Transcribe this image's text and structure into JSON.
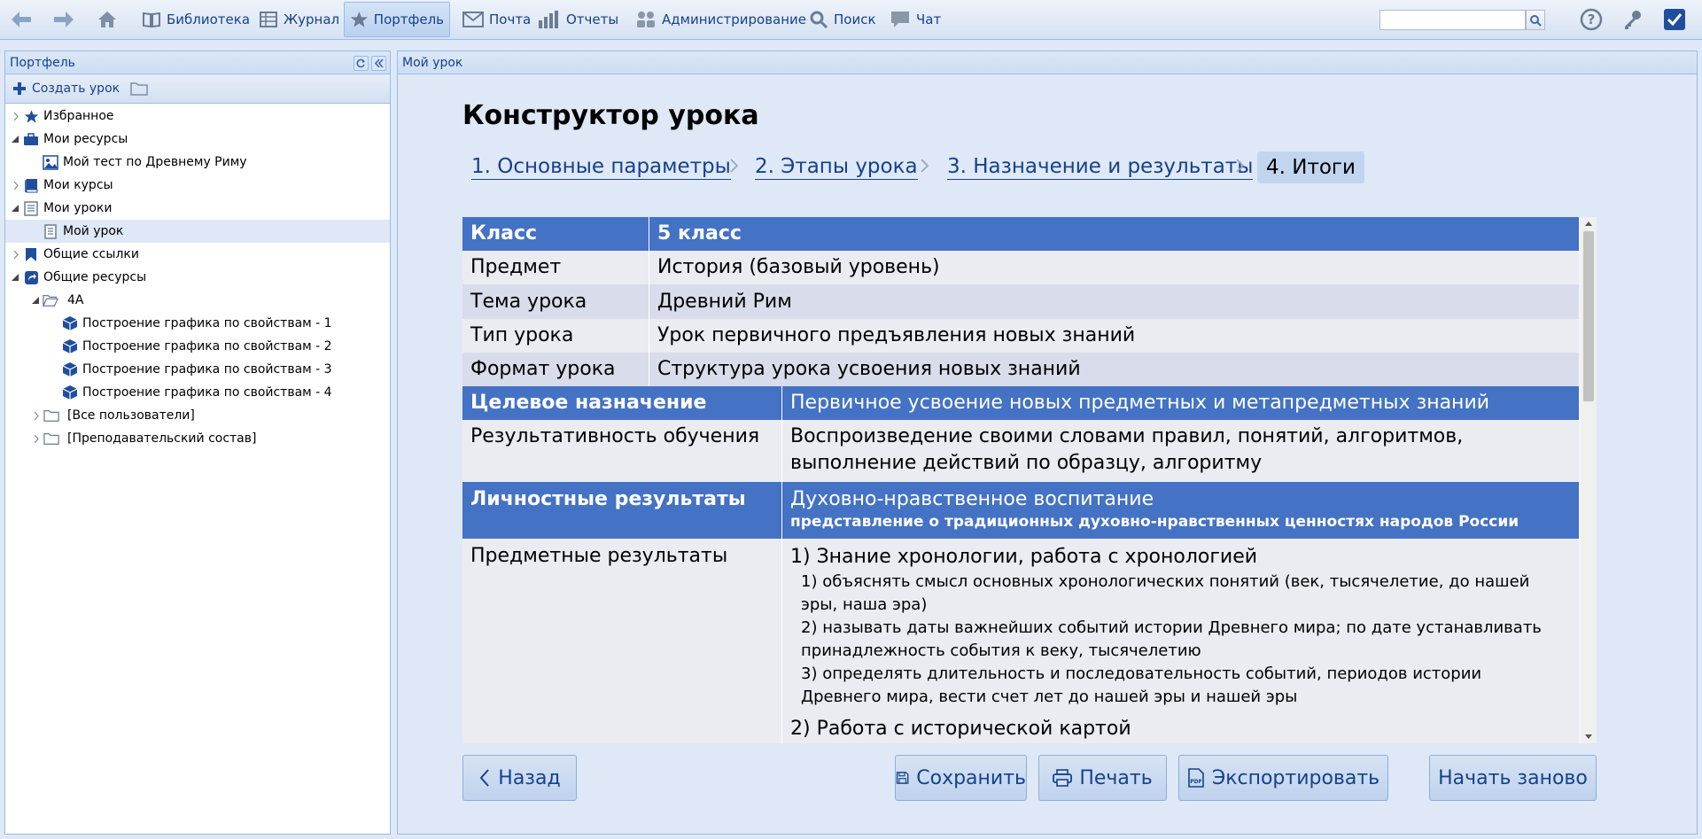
{
  "toolbar": {
    "library": "Библиотека",
    "journal": "Журнал",
    "portfolio": "Портфель",
    "mail": "Почта",
    "reports": "Отчеты",
    "admin": "Администрирование",
    "search": "Поиск",
    "chat": "Чат",
    "search_value": ""
  },
  "left": {
    "title": "Портфель",
    "create_label": "Создать урок",
    "tree": [
      {
        "label": "Избранное"
      },
      {
        "label": "Мои ресурсы"
      },
      {
        "label": "Мой тест по Древнему Риму"
      },
      {
        "label": "Мои курсы"
      },
      {
        "label": "Мои уроки"
      },
      {
        "label": "Мой урок"
      },
      {
        "label": "Общие ссылки"
      },
      {
        "label": "Общие ресурсы"
      },
      {
        "label": "4А"
      },
      {
        "label": "Построение графика по свойствам - 1"
      },
      {
        "label": "Построение графика по свойствам - 2"
      },
      {
        "label": "Построение графика по свойствам - 3"
      },
      {
        "label": "Построение графика по свойствам - 4"
      },
      {
        "label": "[Все пользователи]"
      },
      {
        "label": "[Преподавательский состав]"
      }
    ]
  },
  "right": {
    "tab_title": "Мой урок",
    "page_title": "Конструктор урока",
    "steps": [
      "1. Основные параметры",
      "2. Этапы урока",
      "3. Назначение и результаты",
      "4. Итоги"
    ],
    "summary": {
      "class_label": "Класс",
      "class_value": "5 класс",
      "subject_label": "Предмет",
      "subject_value": "История (базовый уровень)",
      "topic_label": "Тема урока",
      "topic_value": "Древний Рим",
      "type_label": "Тип урока",
      "type_value": "Урок первичного предъявления новых знаний",
      "format_label": "Формат урока",
      "format_value": "Структура урока усвоения новых знаний",
      "purpose_label": "Целевое назначение",
      "purpose_value": "Первичное усвоение новых предметных и метапредметных знаний",
      "effect_label": "Результативность обучения",
      "effect_value": "Воспроизведение своими словами правил, понятий, алгоритмов, выполнение действий по образцу, алгоритму",
      "personal_label": "Личностные результаты",
      "personal_value": "Духовно-нравственное воспитание",
      "personal_sub": "представление о традиционных духовно-нравственных ценностях народов России",
      "subject_results_label": "Предметные результаты",
      "sr_head1": "1) Знание хронологии, работа с хронологией",
      "sr_item1": "1) объяснять смысл основных хронологических понятий (век, тысячелетие, до нашей эры, наша эра)",
      "sr_item2": "2) называть даты важнейших событий истории Древнего мира; по дате устанавливать принадлежность события к веку, тысячелетию",
      "sr_item3": "3) определять длительность и последовательность событий, периодов истории Древнего мира, вести счет лет до нашей эры и нашей эры",
      "sr_head2": "2) Работа с исторической картой"
    },
    "buttons": {
      "back": "Назад",
      "save": "Сохранить",
      "print": "Печать",
      "export": "Экспортировать",
      "restart": "Начать заново"
    }
  },
  "colors": {
    "accent": "#4472c4",
    "panel_bg": "#dfe8f6",
    "link": "#15428b"
  }
}
